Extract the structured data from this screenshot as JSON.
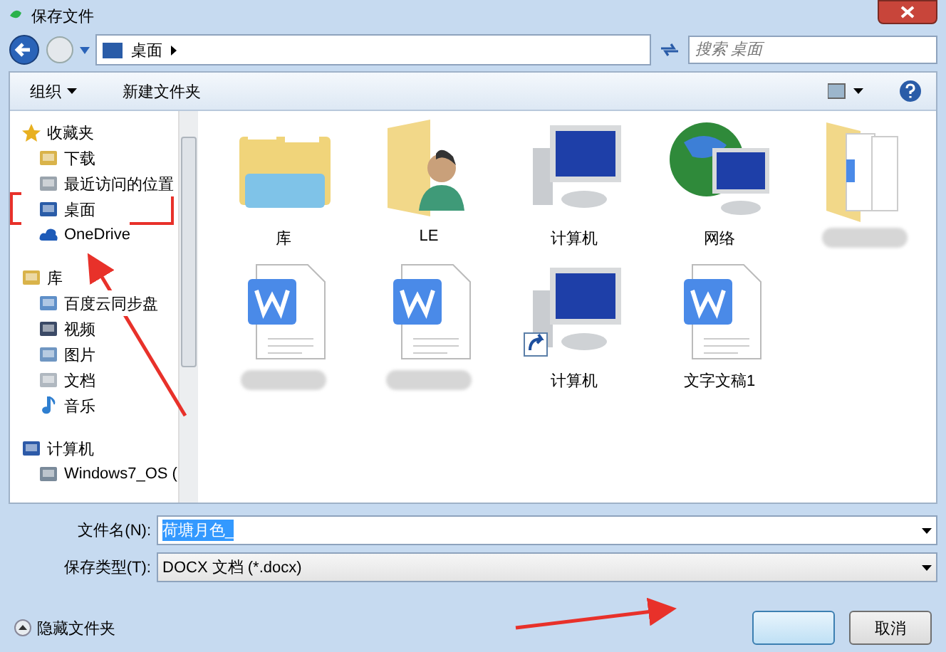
{
  "window": {
    "title": "保存文件"
  },
  "address_bar": {
    "location": "桌面"
  },
  "search": {
    "placeholder": "搜索 桌面"
  },
  "toolbar": {
    "organize": "组织",
    "new_folder": "新建文件夹"
  },
  "sidebar": {
    "groups": [
      {
        "label": "收藏夹",
        "kind": "favorites",
        "children": [
          {
            "label": "下载",
            "kind": "download"
          },
          {
            "label": "最近访问的位置",
            "kind": "recent"
          },
          {
            "label": "桌面",
            "kind": "desktop"
          },
          {
            "label": "OneDrive",
            "kind": "cloud"
          }
        ]
      },
      {
        "label": "库",
        "kind": "library",
        "children": [
          {
            "label": "百度云同步盘",
            "kind": "sync"
          },
          {
            "label": "视频",
            "kind": "video"
          },
          {
            "label": "图片",
            "kind": "picture"
          },
          {
            "label": "文档",
            "kind": "document"
          },
          {
            "label": "音乐",
            "kind": "music"
          }
        ]
      },
      {
        "label": "计算机",
        "kind": "computer",
        "children": [
          {
            "label": "Windows7_OS (",
            "kind": "drive"
          }
        ]
      }
    ]
  },
  "files": [
    {
      "kind": "library",
      "label": "库"
    },
    {
      "kind": "user",
      "label": "LE"
    },
    {
      "kind": "computer",
      "label": "计算机"
    },
    {
      "kind": "network",
      "label": "网络"
    },
    {
      "kind": "folder"
    },
    {
      "kind": "doc"
    },
    {
      "kind": "doc"
    },
    {
      "kind": "shortcut",
      "label": "计算机"
    },
    {
      "kind": "doc",
      "label": "文字文稿1"
    }
  ],
  "form": {
    "filename_label": "文件名(N):",
    "filename": "荷塘月色_",
    "type_label": "保存类型(T):",
    "type": "DOCX 文档 (*.docx)"
  },
  "footer": {
    "hide_folders": "隐藏文件夹",
    "cancel": "取消"
  }
}
